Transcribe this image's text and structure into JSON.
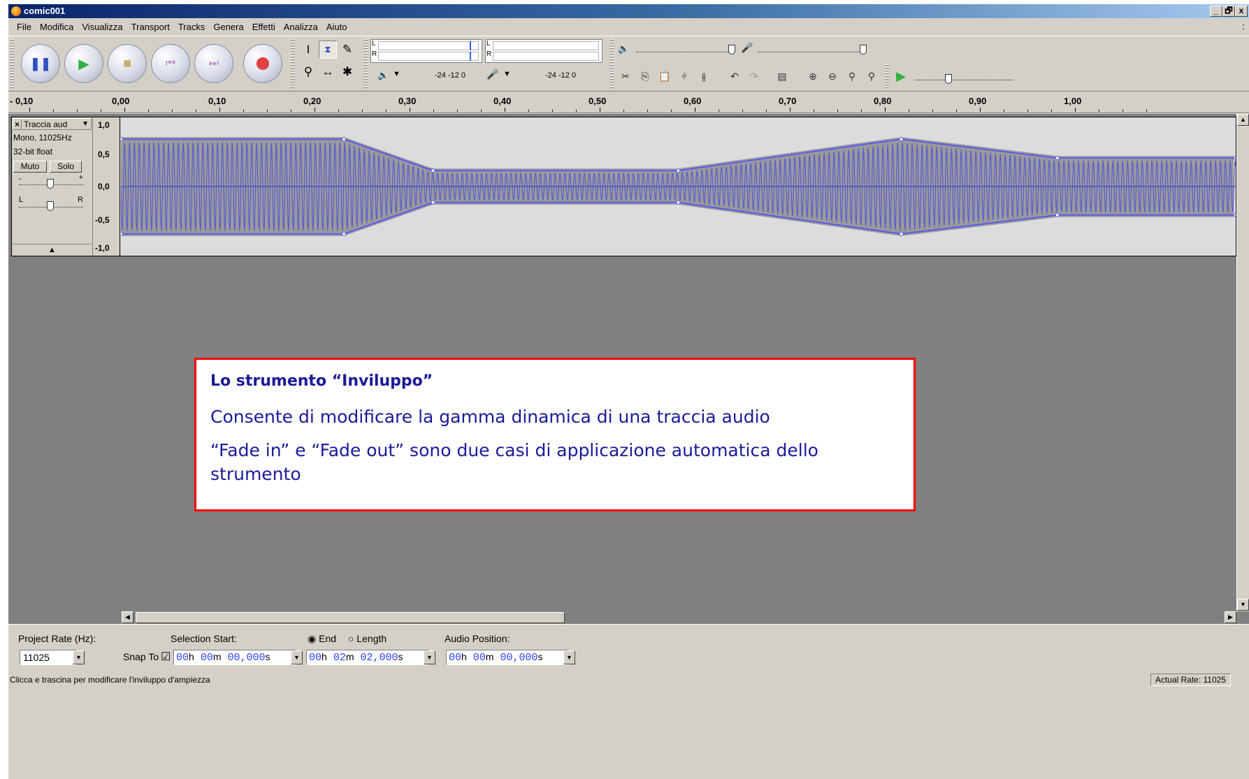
{
  "window": {
    "title": "comic001",
    "minimize": "_",
    "maximize": "🗗",
    "close": "x"
  },
  "menu": {
    "items": [
      "File",
      "Modifica",
      "Visualizza",
      "Transport",
      "Tracks",
      "Genera",
      "Effetti",
      "Analizza",
      "Aiuto"
    ],
    "more": ":"
  },
  "meters": {
    "L": "L",
    "R": "R",
    "scale_play": "-24 -12 0",
    "scale_rec": "-24 -12 0"
  },
  "ruler": {
    "labels": [
      "- 0,10",
      "0,00",
      "0,10",
      "0,20",
      "0,30",
      "0,40",
      "0,50",
      "0,60",
      "0,70",
      "0,80",
      "0,90",
      "1,00"
    ]
  },
  "track": {
    "name": "Traccia aud",
    "close": "×",
    "menu_arrow": "▼",
    "format": "Mono, 11025Hz",
    "bitdepth": "32-bit float",
    "mute": "Muto",
    "solo": "Solo",
    "gain_minus": "-",
    "gain_plus": "+",
    "pan_left": "L",
    "pan_right": "R",
    "collapse": "▲",
    "scale": [
      "1,0",
      "0,5",
      "0,0",
      "-0,5",
      "-1,0"
    ],
    "wave_color": "#5050e0",
    "envelope": [
      {
        "t": 0.0,
        "a": 0.72
      },
      {
        "t": 0.2,
        "a": 0.72
      },
      {
        "t": 0.28,
        "a": 0.22
      },
      {
        "t": 0.5,
        "a": 0.22
      },
      {
        "t": 0.7,
        "a": 0.72
      },
      {
        "t": 0.84,
        "a": 0.42
      },
      {
        "t": 1.0,
        "a": 0.42
      }
    ]
  },
  "selection": {
    "project_rate_label": "Project Rate (Hz):",
    "project_rate": "11025",
    "selection_start_label": "Selection Start:",
    "end_label": "End",
    "length_label": "Length",
    "audio_position_label": "Audio Position:",
    "snap_label": "Snap To",
    "snap_check": "☑",
    "start": {
      "h": "00",
      "m": "00",
      "s": "00,000"
    },
    "end": {
      "h": "00",
      "m": "02",
      "s": "02,000"
    },
    "position": {
      "h": "00",
      "m": "00",
      "s": "00,000"
    },
    "units": {
      "h": "h",
      "m": "m",
      "s": "s"
    }
  },
  "status": {
    "left": "Clicca e trascina per modificare l'inviluppo d'ampiezza",
    "right": "Actual Rate: 11025"
  },
  "callout": {
    "title": "Lo strumento “Inviluppo”",
    "p1": "Consente di modificare la gamma dinamica di una traccia audio",
    "p2": "“Fade in” e “Fade out” sono due casi di applicazione automatica dello strumento"
  },
  "colors": {
    "accent": "#ff0000",
    "callout_text": "#1a1a9a",
    "time_digits": "#2a40ff"
  }
}
